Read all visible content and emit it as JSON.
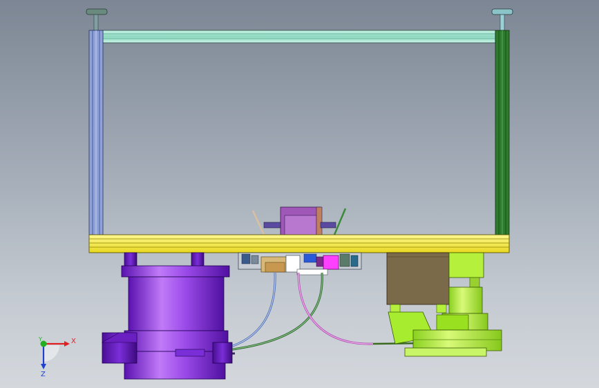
{
  "triad": {
    "x_label": "X",
    "y_label": "Y",
    "z_label": "Z",
    "x_color": "#e02020",
    "y_color": "#20b020",
    "z_color": "#2040d0"
  },
  "colors": {
    "background_top": "#7c8694",
    "background_bottom": "#d4d8dd",
    "frame_top_beam": "#a8e6d2",
    "left_column": "#8fa2d8",
    "right_column": "#2e7a2e",
    "base_plate": "#f2ec3a",
    "left_motor": "#8a35e0",
    "right_assembly": "#b4f03c",
    "gearbox": "#7a6a4a",
    "magenta_part": "#ff40ff"
  },
  "icons": [
    "axis-triad-icon"
  ]
}
